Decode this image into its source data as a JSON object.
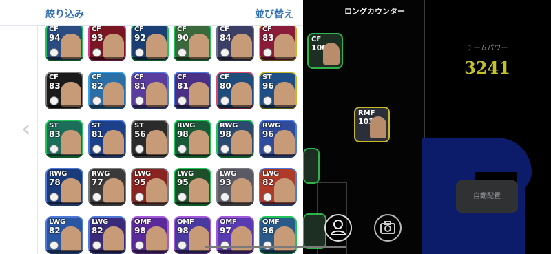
{
  "panel": {
    "filter_label": "絞り込み",
    "sort_label": "並び替え",
    "back_icon": "chevron-left-icon",
    "players": [
      {
        "pos": "CF",
        "ovr": "94",
        "frame": "#22c45a",
        "bg": "#2a4c80"
      },
      {
        "pos": "CF",
        "ovr": "93",
        "frame": "#d23c9c",
        "bg": "#7a1622"
      },
      {
        "pos": "CF",
        "ovr": "92",
        "frame": "#22c45a",
        "bg": "#1b3f74"
      },
      {
        "pos": "CF",
        "ovr": "90",
        "frame": "#22c45a",
        "bg": "#3a6a3c"
      },
      {
        "pos": "CF",
        "ovr": "84",
        "frame": "#6f6f8f",
        "bg": "#3b3f66"
      },
      {
        "pos": "CF",
        "ovr": "83",
        "frame": "#c9b72a",
        "bg": "#8a1c3a"
      },
      {
        "pos": "CF",
        "ovr": "83",
        "frame": "#7c7c7c",
        "bg": "#1b1b1b"
      },
      {
        "pos": "CF",
        "ovr": "82",
        "frame": "#3aa0e0",
        "bg": "#2a6fa8"
      },
      {
        "pos": "CF",
        "ovr": "81",
        "frame": "#4f79d6",
        "bg": "#5a3c9e"
      },
      {
        "pos": "CF",
        "ovr": "81",
        "frame": "#4f79d6",
        "bg": "#4a2f86"
      },
      {
        "pos": "CF",
        "ovr": "80",
        "frame": "#d24a6c",
        "bg": "#1e4d7c"
      },
      {
        "pos": "ST",
        "ovr": "96",
        "frame": "#c9b72a",
        "bg": "#1f4f86"
      },
      {
        "pos": "ST",
        "ovr": "83",
        "frame": "#22c45a",
        "bg": "#1c6e5a"
      },
      {
        "pos": "ST",
        "ovr": "81",
        "frame": "#4f79d6",
        "bg": "#1c3f8a"
      },
      {
        "pos": "ST",
        "ovr": "56",
        "frame": "#7c7c7c",
        "bg": "#2b2b2b"
      },
      {
        "pos": "RWG",
        "ovr": "98",
        "frame": "#22c45a",
        "bg": "#1a5a38"
      },
      {
        "pos": "RWG",
        "ovr": "98",
        "frame": "#22c45a",
        "bg": "#2b4a70"
      },
      {
        "pos": "RWG",
        "ovr": "96",
        "frame": "#4f79d6",
        "bg": "#2e4b9c"
      },
      {
        "pos": "RWG",
        "ovr": "78",
        "frame": "#4f79d6",
        "bg": "#1a3a7a"
      },
      {
        "pos": "RWG",
        "ovr": "77",
        "frame": "#7c7c7c",
        "bg": "#3a3a3a"
      },
      {
        "pos": "LWG",
        "ovr": "95",
        "frame": "#7c7c7c",
        "bg": "#8a2420"
      },
      {
        "pos": "LWG",
        "ovr": "95",
        "frame": "#22c45a",
        "bg": "#1f4f2a"
      },
      {
        "pos": "LWG",
        "ovr": "93",
        "frame": "#7c7c7c",
        "bg": "#5a5a66"
      },
      {
        "pos": "LWG",
        "ovr": "82",
        "frame": "#4f79d6",
        "bg": "#b03a2a"
      },
      {
        "pos": "LWG",
        "ovr": "82",
        "frame": "#4f79d6",
        "bg": "#2a55a0"
      },
      {
        "pos": "LWG",
        "ovr": "82",
        "frame": "#4f79d6",
        "bg": "#3a2a7a"
      },
      {
        "pos": "OMF",
        "ovr": "98",
        "frame": "#a45ad6",
        "bg": "#5a2a9a"
      },
      {
        "pos": "OMF",
        "ovr": "98",
        "frame": "#a45ad6",
        "bg": "#4a3aa0"
      },
      {
        "pos": "OMF",
        "ovr": "97",
        "frame": "#a45ad6",
        "bg": "#5a3ab0"
      },
      {
        "pos": "OMF",
        "ovr": "96",
        "frame": "#22c45a",
        "bg": "#2a5a8a"
      }
    ]
  },
  "pitch": {
    "formation_title": "ロングカウンター",
    "players": [
      {
        "pos": "CF",
        "ovr": "100"
      },
      {
        "pos": "RMF",
        "ovr": "103"
      }
    ]
  },
  "team_power": {
    "label": "チームパワー",
    "value": "3241"
  },
  "buttons": {
    "auto_assign": "自動配置",
    "person_icon": "person-icon",
    "camera_icon": "camera-icon"
  },
  "colors": {
    "accent_blue": "#2f6fb5",
    "team_power_yellow": "#c4c12d"
  }
}
